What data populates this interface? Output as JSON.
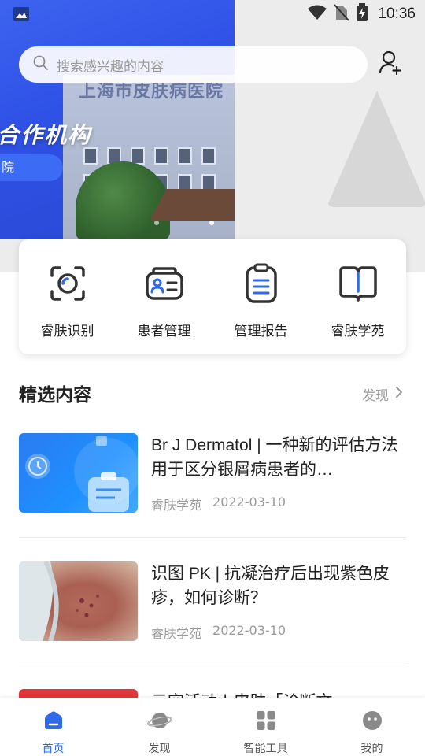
{
  "status_bar": {
    "time": "10:36",
    "icons": [
      "image-icon",
      "wifi-icon",
      "no-sim-icon",
      "battery-charging-icon"
    ]
  },
  "banner": {
    "headline": "合作机构",
    "pill_text": "院",
    "sign_text": "上海市皮肤病医院",
    "slides": 2,
    "active_slide": 1
  },
  "search": {
    "placeholder": "搜索感兴趣的内容",
    "icon": "search-icon"
  },
  "header_actions": {
    "add_user_icon": "add-user-icon"
  },
  "quick_actions": [
    {
      "label": "睿肤识别",
      "icon": "scan-camera-icon"
    },
    {
      "label": "患者管理",
      "icon": "id-card-icon"
    },
    {
      "label": "管理报告",
      "icon": "clipboard-icon"
    },
    {
      "label": "睿肤学苑",
      "icon": "open-book-icon"
    }
  ],
  "section": {
    "title": "精选内容",
    "more_label": "发现"
  },
  "articles": [
    {
      "title": "Br J Dermatol | 一种新的评估方法用于区分银屑病患者的…",
      "source": "睿肤学苑",
      "date": "2022-03-10"
    },
    {
      "title": "识图 PK | 抗凝治疗后出现紫色皮疹，如何诊断？",
      "source": "睿肤学苑",
      "date": "2022-03-10"
    },
    {
      "title": "云空活动 | 皮肤「诊断文"
    }
  ],
  "bottom_nav": [
    {
      "label": "首页",
      "icon": "home-icon",
      "active": true
    },
    {
      "label": "发现",
      "icon": "planet-icon",
      "active": false
    },
    {
      "label": "智能工具",
      "icon": "grid-apps-icon",
      "active": false
    },
    {
      "label": "我的",
      "icon": "smiley-face-icon",
      "active": false
    }
  ],
  "colors": {
    "primary": "#2f6ae8",
    "banner_blue": "#3058ea",
    "text": "#222222",
    "muted": "#9a9a9a"
  }
}
